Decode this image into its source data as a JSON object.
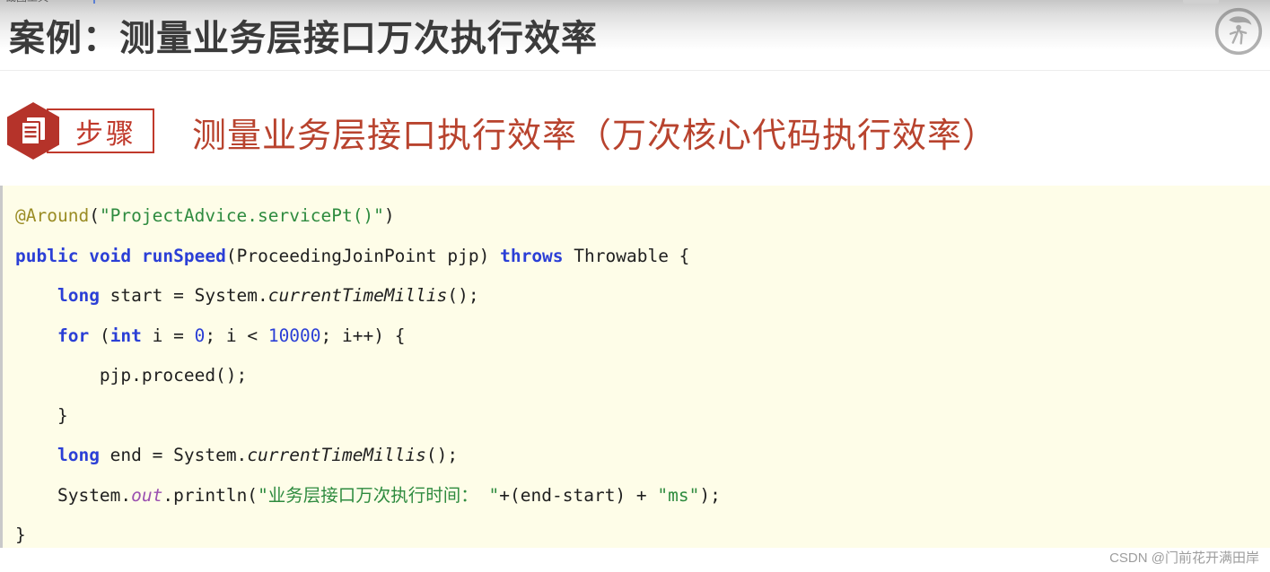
{
  "chrome": {
    "tab_label": "截图工具",
    "window_control_label": ""
  },
  "header": {
    "title": "案例：测量业务层接口万次执行效率",
    "logo_icon": "circular-runner-logo-icon",
    "background_top_color": "#c6c6c6",
    "background_bottom_color": "#ffffff",
    "title_color": "#3b3b3b"
  },
  "step_section": {
    "badge_icon": "document-list-icon",
    "badge_label": "步骤",
    "badge_color": "#c0392b",
    "heading": "测量业务层接口执行效率（万次核心代码执行效率）",
    "heading_color": "#b8432e"
  },
  "code_block": {
    "background_color": "#fefde8",
    "border_color": "#c9c9c9",
    "language": "java",
    "lines": [
      {
        "indent": 0,
        "tokens": [
          {
            "text": "@Around",
            "type": "annotation"
          },
          {
            "text": "(",
            "type": "plain"
          },
          {
            "text": "\"ProjectAdvice.servicePt()\"",
            "type": "string"
          },
          {
            "text": ")",
            "type": "plain"
          }
        ]
      },
      {
        "indent": 0,
        "tokens": [
          {
            "text": "public",
            "type": "keyword"
          },
          {
            "text": " ",
            "type": "plain"
          },
          {
            "text": "void",
            "type": "keyword"
          },
          {
            "text": " ",
            "type": "plain"
          },
          {
            "text": "runSpeed",
            "type": "keyword"
          },
          {
            "text": "(ProceedingJoinPoint pjp) ",
            "type": "plain"
          },
          {
            "text": "throws",
            "type": "keyword"
          },
          {
            "text": " Throwable {",
            "type": "plain"
          }
        ]
      },
      {
        "indent": 1,
        "tokens": [
          {
            "text": "long",
            "type": "keyword"
          },
          {
            "text": " start = System.",
            "type": "plain"
          },
          {
            "text": "currentTimeMillis",
            "type": "italic"
          },
          {
            "text": "();",
            "type": "plain"
          }
        ]
      },
      {
        "indent": 1,
        "tokens": [
          {
            "text": "for",
            "type": "keyword"
          },
          {
            "text": " (",
            "type": "plain"
          },
          {
            "text": "int",
            "type": "keyword"
          },
          {
            "text": " i = ",
            "type": "plain"
          },
          {
            "text": "0",
            "type": "number"
          },
          {
            "text": "; i < ",
            "type": "plain"
          },
          {
            "text": "10000",
            "type": "number"
          },
          {
            "text": "; i++) {",
            "type": "plain"
          }
        ]
      },
      {
        "indent": 2,
        "tokens": [
          {
            "text": "pjp.proceed();",
            "type": "plain"
          }
        ]
      },
      {
        "indent": 1,
        "tokens": [
          {
            "text": "}",
            "type": "plain"
          }
        ]
      },
      {
        "indent": 1,
        "tokens": [
          {
            "text": "long",
            "type": "keyword"
          },
          {
            "text": " end = System.",
            "type": "plain"
          },
          {
            "text": "currentTimeMillis",
            "type": "italic"
          },
          {
            "text": "();",
            "type": "plain"
          }
        ]
      },
      {
        "indent": 1,
        "tokens": [
          {
            "text": "System.",
            "type": "plain"
          },
          {
            "text": "out",
            "type": "field"
          },
          {
            "text": ".println(",
            "type": "plain"
          },
          {
            "text": "\"业务层接口万次执行时间： \"",
            "type": "string"
          },
          {
            "text": "+(end-start) + ",
            "type": "plain"
          },
          {
            "text": "\"ms\"",
            "type": "string"
          },
          {
            "text": ");",
            "type": "plain"
          }
        ]
      },
      {
        "indent": 0,
        "tokens": [
          {
            "text": "}",
            "type": "plain"
          }
        ]
      }
    ]
  },
  "watermark": {
    "text": "CSDN @门前花开满田岸"
  }
}
